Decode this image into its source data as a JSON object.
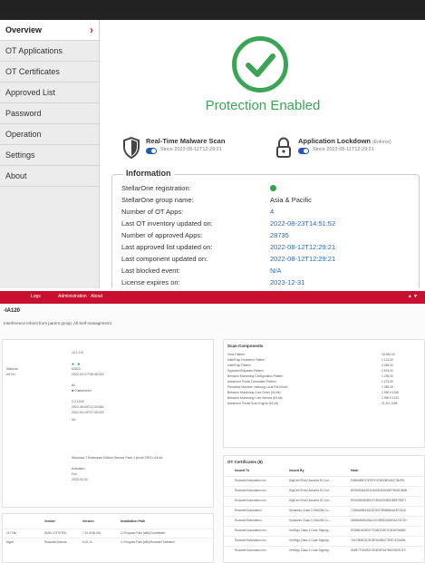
{
  "agent": {
    "sidebar": [
      {
        "label": "Overview",
        "active": true
      },
      {
        "label": "OT Applications"
      },
      {
        "label": "OT Certificates"
      },
      {
        "label": "Approved List"
      },
      {
        "label": "Password"
      },
      {
        "label": "Operation"
      },
      {
        "label": "Settings"
      },
      {
        "label": "About"
      }
    ],
    "status": "Protection Enabled",
    "features": [
      {
        "title": "Real-Time Malware Scan",
        "note": "",
        "since": "Since 2022-05-11T12:29:21"
      },
      {
        "title": "Application Lockdown",
        "note": "(Enforce)",
        "since": "Since 2022-05-11T12:29:21"
      }
    ],
    "info_title": "Information",
    "info": [
      {
        "label": "StellarOne registration:",
        "value": ""
      },
      {
        "label": "StellarOne group name:",
        "value": "Asia & Pacific"
      },
      {
        "label": "Number of OT Apps:",
        "value": "4"
      },
      {
        "label": "Last OT inventory updated on:",
        "value": "2022-08-23T14:51:52"
      },
      {
        "label": "Number of approved Apps:",
        "value": "28735"
      },
      {
        "label": "Last approved list updated on:",
        "value": "2022-08-12T12:29:21"
      },
      {
        "label": "Last component updated on:",
        "value": "2022-08-12T12:29:21"
      },
      {
        "label": "Last blocked event:",
        "value": "N/A"
      },
      {
        "label": "License expires on:",
        "value": "2023-12-31"
      }
    ],
    "colors": {
      "accent": "#3aa655",
      "link": "#2a66c2",
      "brand": "#d0202a"
    }
  },
  "console": {
    "nav": [
      "Logs",
      "Administration",
      "About"
    ],
    "title": "-IA120",
    "inherit": "Interference   Inherit from parent group: All   Self-management",
    "scan_title": "Scan Components",
    "scan_rows": [
      {
        "name": "Virus Pattern",
        "value": "18.265.00"
      },
      {
        "name": "IntelliTrap Exception Pattern",
        "value": "2.121.00"
      },
      {
        "name": "IntelliTrap Pattern",
        "value": "0.265.00"
      },
      {
        "name": "Spyware/Grayware Pattern",
        "value": "2.613.00"
      },
      {
        "name": "Behavior Monitoring Configuration Pattern",
        "value": "1.235.00"
      },
      {
        "name": "Advanced Threat Correlation Pattern",
        "value": "1.273.00"
      },
      {
        "name": "Predictive Machine Learning Local File Model",
        "value": "2.389.00"
      },
      {
        "name": "Behavior Monitoring Core Driver (64-bit)",
        "value": "2.990.0.1155"
      },
      {
        "name": "Behavior Monitoring Core Service (64-bit)",
        "value": "2.990.0.1212"
      },
      {
        "name": "Advanced Threat Scan Engine (64-bit)",
        "value": "21.8.0.1096"
      }
    ],
    "cert_title": "OT Certificates (8)",
    "cert_headers": [
      "Issued To",
      "Issued By",
      "Hash"
    ],
    "cert_rows": [
      {
        "to": "Rockwell Automation Inc.",
        "by": "DigiCert SHA2 Assured ID Cod...",
        "hash": "E0B6485F0787EFF4F6D65E4A027B4FB"
      },
      {
        "to": "Rockwell Automation Inc.",
        "by": "DigiCert SHA2 Assured ID Cod...",
        "hash": "B9CB0D6A3E3C6A5D4D0D6EF3E6D1B6B"
      },
      {
        "to": "Rockwell Automation Inc.",
        "by": "DigiCert SHA2 Assured ID Cod...",
        "hash": "8F4D6BCB4B0CF1B41ED3BD1B8F7B0F1"
      },
      {
        "to": "Rockwell Automation",
        "by": "Symantec Class 3 SHA256 Co...",
        "hash": "7CB6A6B6213C6CB7C9B9B6B4A3F1D2A"
      },
      {
        "to": "Rockwell Automation",
        "by": "Symantec Class 3 SHA256 Co...",
        "hash": "0BDB0B6D4D6A10C2B5D3A5E0A1F2C3D"
      },
      {
        "to": "Rockwell Automation Inc.",
        "by": "VeriSign Class 3 Code Signing...",
        "hash": "9F2B6D4DB21F7C6B7D3E1C9D4F0A8B2"
      },
      {
        "to": "Rockwell Automation Inc.",
        "by": "VeriSign Class 3 Code Signing...",
        "hash": "7A1F9B6D2C4E8F0A3B5C7D9E1F2A4B6"
      },
      {
        "to": "Rockwell Automation Inc.",
        "by": "VeriSign Class 3 Code Signing...",
        "hash": "6D8E7F0A1B2C3D4E5F6A7B8C9D0E1F2"
      }
    ],
    "left_rows": [
      {
        "key": "",
        "value": "10.1.0.8"
      },
      {
        "key": "Stations",
        "value": "62620"
      },
      {
        "key": "ed On",
        "value": "2022-04-07T08:36:202"
      },
      {
        "key": "",
        "value": "All"
      },
      {
        "key": "",
        "value": "■ Customized"
      },
      {
        "key": "",
        "value": "2.2.1043"
      },
      {
        "key": "",
        "value": "2022-05-06T12:24:582"
      },
      {
        "key": "",
        "value": "2022-04-19T07:49:022"
      },
      {
        "key": "",
        "value": "No"
      },
      {
        "key": "",
        "value": "Windows 7 Enterprise Edition Service Pack 1 (build 7601), 64-bit"
      },
      {
        "key": "",
        "value": "Activated"
      },
      {
        "key": "",
        "value": "Full"
      },
      {
        "key": "",
        "value": "2023-03-31"
      }
    ],
    "prog_headers": [
      "Vendor",
      "Version",
      "Installation Path"
    ],
    "prog_rows": [
      {
        "name": "x17 File",
        "vendor": "SMSL IOTSTEM...",
        "ver": "7.10.4196.061",
        "path": "C:\\Program Files (x86)\\CodeMeter\\"
      },
      {
        "name": "Mgmt",
        "vendor": "Rockwell Automa...",
        "ver": "6.00.14",
        "path": "C:\\Program Files (x86)\\Rockwell Software\\"
      }
    ]
  }
}
